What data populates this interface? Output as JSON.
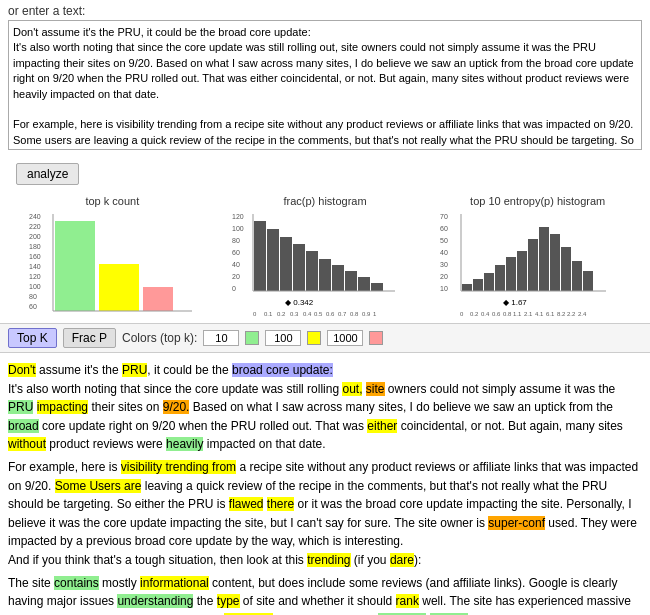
{
  "top_label": "or enter a text:",
  "textarea_content": "Don't assume it's the PRU, it could be the broad core update:\nIt's also worth noting that since the core update was still rolling out, site owners could not simply assume it was the PRU impacting their sites on 9/20. Based on what I saw across many sites, I do believe we saw an uptick from the broad core update right on 9/20 when the PRU rolled out. That was either coincidental, or not. But again, many sites without product reviews were heavily impacted on that date.\n\nFor example, here is visibility trending from a recipe site without any product reviews or affiliate links that was impacted on 9/20. Some users are leaving a quick review of the recipe in the comments, but that's not really what the PRU should be targeting. So either the PRU is flawed there or it was the broad core update impacting the site. Personally, I believe it was the core update impacting the site, but I can't say for sure. The site owner is super-confused. They were impacted by a",
  "analyze_label": "analyze",
  "charts": {
    "top_k": {
      "title": "top k count"
    },
    "frac_p": {
      "title": "frac(p) histogram",
      "value": "◆ 0.342",
      "x_labels": "0 0.1 0.2 0.3 0.4 0.5 0.6 0.7 0.8 0.9 1"
    },
    "entropy": {
      "title": "top 10 entropy(p) histogram",
      "value": "◆ 1.67",
      "x_labels": "0 0.2 0.4 0.6 0.8 1.1 2.1 4.1 6.1 8.2 2.2 2.4"
    }
  },
  "controls": {
    "top_k_label": "Top K",
    "frac_p_label": "Frac P",
    "colors_label": "Colors (top k):",
    "val1": "10",
    "val2": "100",
    "val3": "1000"
  },
  "content_lines": [
    "main_text_block"
  ]
}
